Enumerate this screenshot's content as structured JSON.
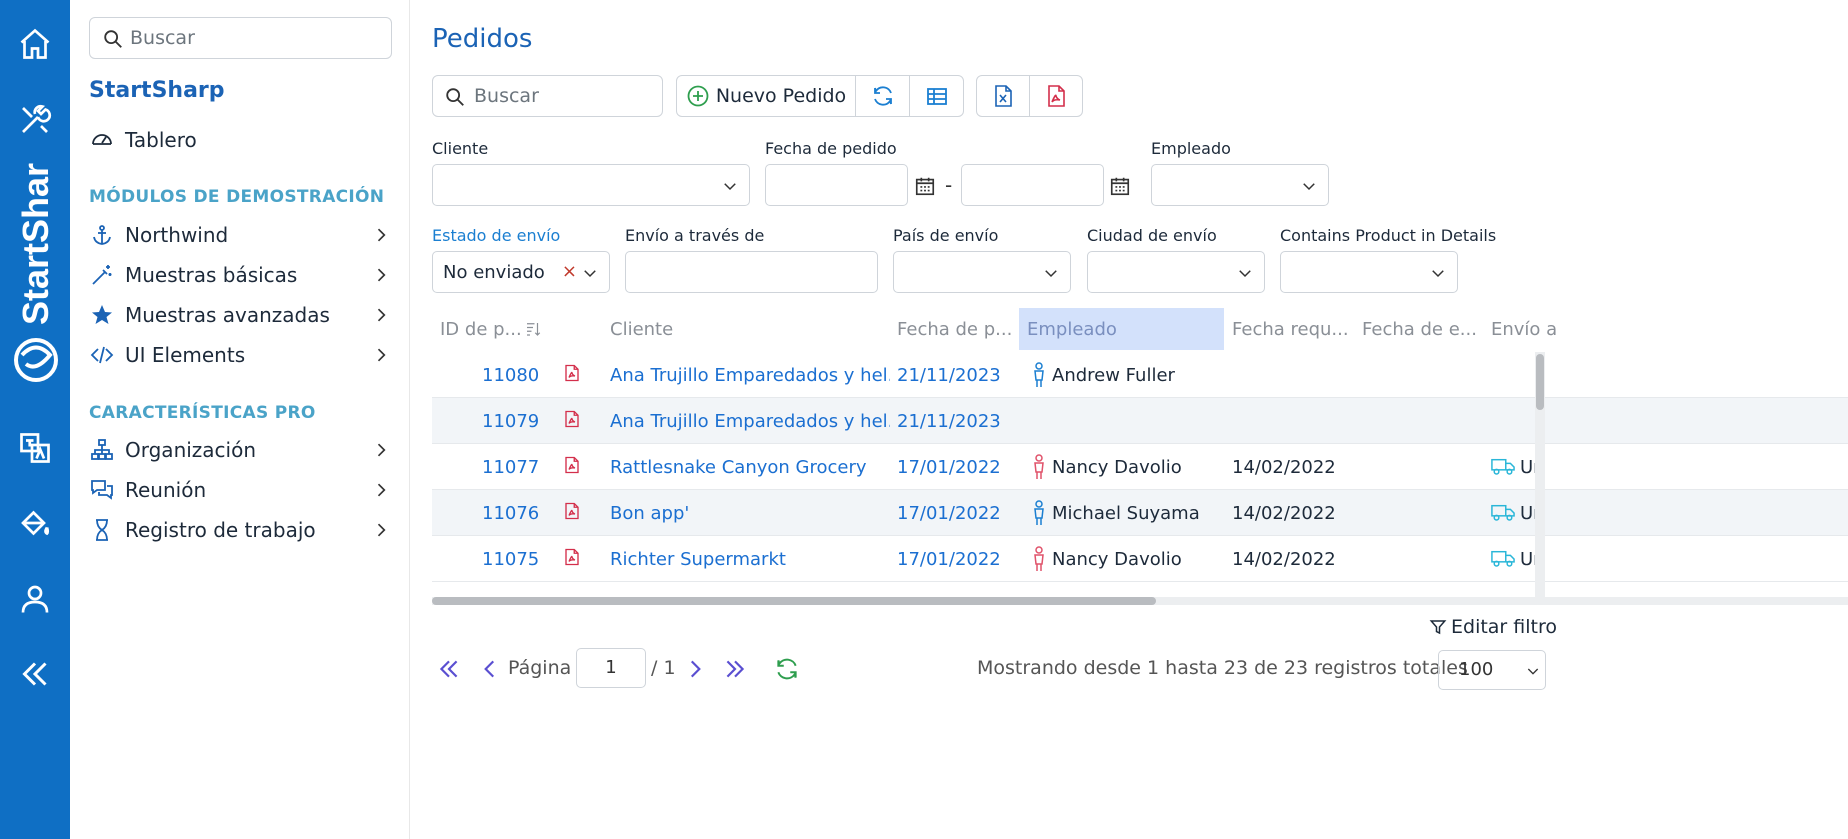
{
  "brand": {
    "rail_text": "StartShar"
  },
  "rail": {
    "icons": [
      "home-icon",
      "tools-icon",
      "translate-icon",
      "paint-bucket-icon",
      "user-icon",
      "collapse-icon"
    ]
  },
  "sidebar": {
    "search_placeholder": "Buscar",
    "app_name": "StartSharp",
    "dashboard_label": "Tablero",
    "section_demo": "MÓDULOS DE DEMOSTRACIÓN",
    "demo_items": [
      {
        "label": "Northwind",
        "icon": "anchor-icon"
      },
      {
        "label": "Muestras básicas",
        "icon": "magic-wand-icon"
      },
      {
        "label": "Muestras avanzadas",
        "icon": "star-icon"
      },
      {
        "label": "UI Elements",
        "icon": "code-icon"
      }
    ],
    "section_pro": "CARACTERÍSTICAS PRO",
    "pro_items": [
      {
        "label": "Organización",
        "icon": "sitemap-icon"
      },
      {
        "label": "Reunión",
        "icon": "chat-icon"
      },
      {
        "label": "Registro de trabajo",
        "icon": "hourglass-icon"
      }
    ]
  },
  "page": {
    "title": "Pedidos",
    "search_placeholder": "Buscar",
    "new_order_label": "Nuevo Pedido"
  },
  "filters": {
    "cliente_label": "Cliente",
    "fecha_pedido_label": "Fecha de pedido",
    "date_separator": "-",
    "empleado_label": "Empleado",
    "estado_envio_label": "Estado de envío",
    "estado_envio_value": "No enviado",
    "clear_symbol": "×",
    "envio_traves_label": "Envío a través de",
    "pais_envio_label": "País de envío",
    "ciudad_envio_label": "Ciudad de envío",
    "contains_product_label": "Contains Product in Details"
  },
  "grid": {
    "columns": [
      "ID de p...",
      "Cliente",
      "Fecha de p...",
      "Empleado",
      "Fecha requ...",
      "Fecha de e...",
      "Envío a"
    ],
    "rows": [
      {
        "id": "11080",
        "cliente": "Ana Trujillo Emparedados y hel...",
        "fecha": "21/11/2023",
        "empleado": "Andrew Fuller",
        "gender": "male",
        "requerida": "",
        "envio": ""
      },
      {
        "id": "11079",
        "cliente": "Ana Trujillo Emparedados y hel...",
        "fecha": "21/11/2023",
        "empleado": "",
        "gender": "",
        "requerida": "",
        "envio": ""
      },
      {
        "id": "11077",
        "cliente": "Rattlesnake Canyon Grocery",
        "fecha": "17/01/2022",
        "empleado": "Nancy Davolio",
        "gender": "female",
        "requerida": "14/02/2022",
        "envio": "Un"
      },
      {
        "id": "11076",
        "cliente": "Bon app'",
        "fecha": "17/01/2022",
        "empleado": "Michael Suyama",
        "gender": "male",
        "requerida": "14/02/2022",
        "envio": "Un"
      },
      {
        "id": "11075",
        "cliente": "Richter Supermarkt",
        "fecha": "17/01/2022",
        "empleado": "Nancy Davolio",
        "gender": "female",
        "requerida": "14/02/2022",
        "envio": "Un"
      }
    ]
  },
  "footer": {
    "edit_filter_label": "Editar filtro",
    "page_label": "Página",
    "page_value": "1",
    "page_total": "/ 1",
    "info": "Mostrando desde 1 hasta 23 de 23 registros totales",
    "page_size": "100"
  },
  "colors": {
    "rail": "#0f6fc4",
    "accent": "#1b63b5",
    "link": "#1b6fd1",
    "section": "#4aa3c8",
    "pdf": "#d32f4b",
    "male": "#1b7fd1",
    "female": "#e0526a",
    "truck": "#29b6d8"
  }
}
